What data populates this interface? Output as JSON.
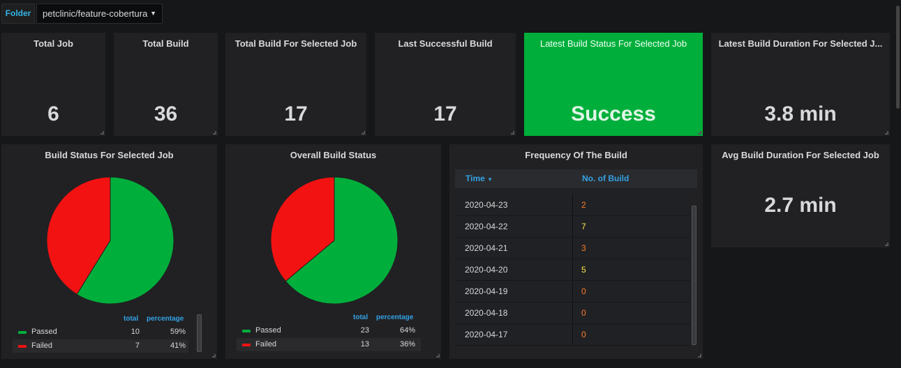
{
  "folder": {
    "label": "Folder",
    "selected": "petclinic/feature-cobertura"
  },
  "stats": [
    {
      "title": "Total Job",
      "value": "6"
    },
    {
      "title": "Total Build",
      "value": "36"
    },
    {
      "title": "Total Build For Selected Job",
      "value": "17"
    },
    {
      "title": "Last Successful Build",
      "value": "17"
    },
    {
      "title": "Latest Build Status For Selected Job",
      "value": "Success"
    },
    {
      "title": "Latest Build Duration For Selected J...",
      "value": "3.8 min"
    },
    {
      "title": "Avg Build Duration For Selected Job",
      "value": "2.7 min"
    }
  ],
  "colors": {
    "passed": "#00af3b",
    "failed": "#f21212",
    "success_bg": "#00af3b",
    "accent": "#33a2e5",
    "count_orange": "#ff7c2b",
    "count_yellow": "#fce94f"
  },
  "pie1": {
    "title": "Build Status For Selected Job",
    "col_total": "total",
    "col_percentage": "percentage",
    "rows": [
      {
        "name": "Passed",
        "total": "10",
        "percentage": "59%"
      },
      {
        "name": "Failed",
        "total": "7",
        "percentage": "41%"
      }
    ]
  },
  "pie2": {
    "title": "Overall Build Status",
    "col_total": "total",
    "col_percentage": "percentage",
    "rows": [
      {
        "name": "Passed",
        "total": "23",
        "percentage": "64%"
      },
      {
        "name": "Failed",
        "total": "13",
        "percentage": "36%"
      }
    ]
  },
  "table": {
    "title": "Frequency Of The Build",
    "col_time": "Time",
    "col_count": "No. of Build",
    "rows": [
      {
        "time": "2020-04-23",
        "count": "2"
      },
      {
        "time": "2020-04-22",
        "count": "7"
      },
      {
        "time": "2020-04-21",
        "count": "3"
      },
      {
        "time": "2020-04-20",
        "count": "5"
      },
      {
        "time": "2020-04-19",
        "count": "0"
      },
      {
        "time": "2020-04-18",
        "count": "0"
      },
      {
        "time": "2020-04-17",
        "count": "0"
      }
    ]
  },
  "chart_data": [
    {
      "type": "pie",
      "title": "Build Status For Selected Job",
      "categories": [
        "Passed",
        "Failed"
      ],
      "values": [
        10,
        7
      ],
      "percentages": [
        59,
        41
      ],
      "colors": [
        "#00af3b",
        "#f21212"
      ],
      "legend": "bottom"
    },
    {
      "type": "pie",
      "title": "Overall Build Status",
      "categories": [
        "Passed",
        "Failed"
      ],
      "values": [
        23,
        13
      ],
      "percentages": [
        64,
        36
      ],
      "colors": [
        "#00af3b",
        "#f21212"
      ],
      "legend": "bottom"
    },
    {
      "type": "table",
      "title": "Frequency Of The Build",
      "columns": [
        "Time",
        "No. of Build"
      ],
      "rows": [
        [
          "2020-04-23",
          2
        ],
        [
          "2020-04-22",
          7
        ],
        [
          "2020-04-21",
          3
        ],
        [
          "2020-04-20",
          5
        ],
        [
          "2020-04-19",
          0
        ],
        [
          "2020-04-18",
          0
        ],
        [
          "2020-04-17",
          0
        ]
      ]
    }
  ]
}
